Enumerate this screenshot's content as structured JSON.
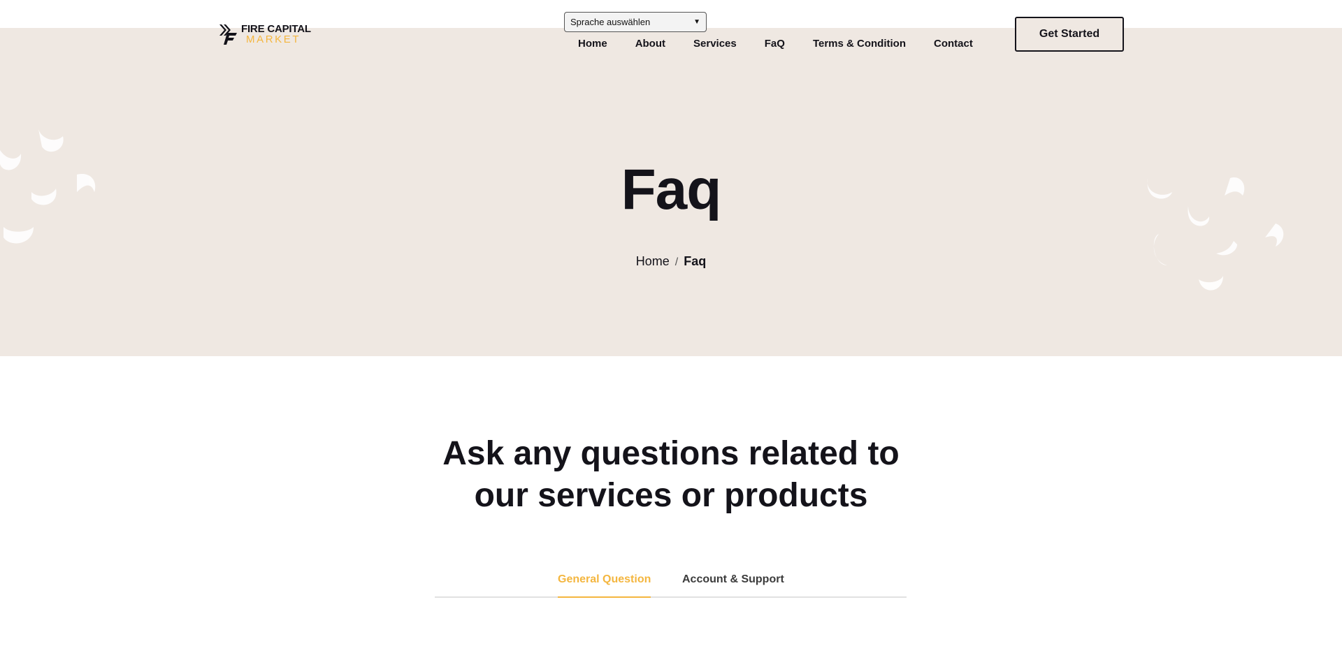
{
  "header": {
    "logo_top": "FIRE CAPITAL",
    "logo_bottom": "MARKET",
    "language_select": "Sprache auswählen",
    "nav": [
      "Home",
      "About",
      "Services",
      "FaQ",
      "Terms & Condition",
      "Contact"
    ],
    "cta_label": "Get Started"
  },
  "hero": {
    "title": "Faq",
    "breadcrumb_home": "Home",
    "breadcrumb_sep": "/",
    "breadcrumb_current": "Faq"
  },
  "faq": {
    "title_line1": "Ask any questions related to",
    "title_line2": "our services or products",
    "tabs": [
      "General Question",
      "Account & Support"
    ],
    "active_tab": "General Question"
  },
  "colors": {
    "hero_bg": "#efe8e2",
    "accent": "#f4b63f",
    "text": "#14131a"
  },
  "icons": [
    "logo-mark-icon",
    "chevron-down-icon",
    "decorative-crescent-icon"
  ]
}
